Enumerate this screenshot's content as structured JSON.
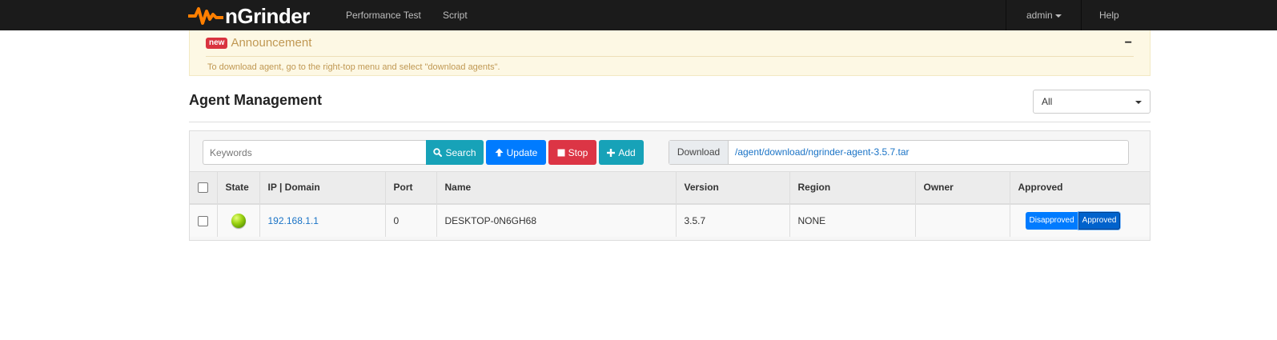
{
  "navbar": {
    "brand": "nGrinder",
    "brand_color": "#ff7f00",
    "links": {
      "performance_test": "Performance Test",
      "script": "Script"
    },
    "user": "admin",
    "help": "Help"
  },
  "announcement": {
    "badge": "new",
    "title": "Announcement",
    "collapse_symbol": "−",
    "body": "To download agent, go to the right-top menu and select \"download agents\"."
  },
  "page": {
    "title": "Agent Management",
    "region_filter": "All"
  },
  "toolbar": {
    "search_placeholder": "Keywords",
    "search_label": "Search",
    "update_label": "Update",
    "stop_label": "Stop",
    "add_label": "Add",
    "download_label": "Download",
    "download_path": "/agent/download/ngrinder-agent-3.5.7.tar"
  },
  "table": {
    "headers": {
      "state": "State",
      "ip_domain": "IP | Domain",
      "port": "Port",
      "name": "Name",
      "version": "Version",
      "region": "Region",
      "owner": "Owner",
      "approved": "Approved"
    },
    "rows": [
      {
        "state": "ready",
        "ip": "192.168.1.1",
        "port": "0",
        "name": "DESKTOP-0N6GH68",
        "version": "3.5.7",
        "region": "NONE",
        "owner": "",
        "disapproved_label": "Disapproved",
        "approved_label": "Approved",
        "approved_selected": true
      }
    ]
  },
  "colors": {
    "navbar_bg": "#1b1b1b",
    "accent_blue": "#007bff",
    "info_teal": "#17a2b8",
    "danger_red": "#dc3545",
    "announcement_bg": "#fdf8e4"
  },
  "icons": {
    "search": "search-icon",
    "update": "arrow-up-icon",
    "stop": "stop-square-icon",
    "add": "plus-icon"
  }
}
